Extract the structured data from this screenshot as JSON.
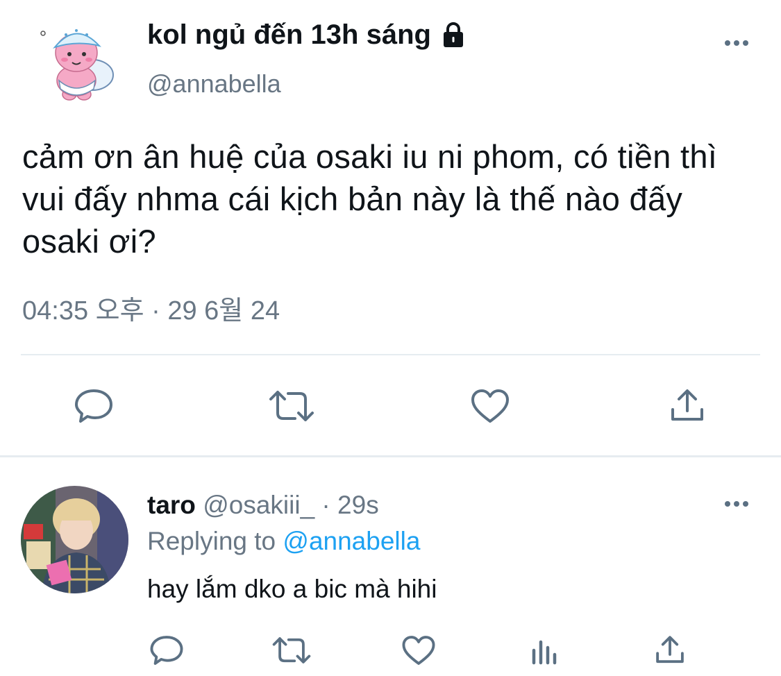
{
  "tweet": {
    "display_name": "kol ngủ đến 13h sáng",
    "handle": "@annabella",
    "text": "cảm ơn ân huệ của osaki iu ni phom, có tiền thì vui đấy nhma cái kịch bản này là thế nào đấy osaki ơi?",
    "timestamp": "04:35 오후 · 29 6월 24",
    "icons": [
      "lock-icon",
      "more-icon",
      "reply-icon",
      "retweet-icon",
      "like-icon",
      "share-icon"
    ]
  },
  "reply": {
    "name": "taro",
    "handle": "@osakiii_",
    "separator": " · ",
    "time": "29s",
    "replying_prefix": "Replying to ",
    "replying_handle": "@annabella",
    "text": "hay lắm dko a bic mà hihi",
    "icons": [
      "reply-icon",
      "retweet-icon",
      "like-icon",
      "stats-icon",
      "share-icon"
    ]
  },
  "colors": {
    "text": "#0f1419",
    "muted": "#687684",
    "link": "#1da1f2",
    "divider": "#e6ecf0",
    "icon": "#5b7083"
  }
}
